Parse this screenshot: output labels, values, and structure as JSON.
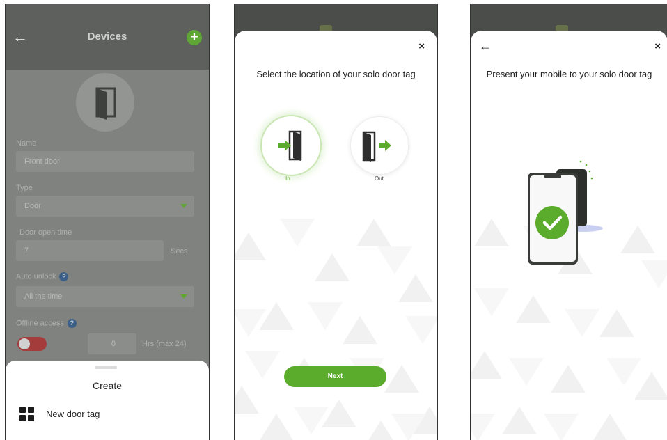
{
  "screen1": {
    "header": {
      "title": "Devices",
      "back_icon": "arrow-left-icon",
      "add_icon": "plus-circle-icon",
      "add_symbol": "+"
    },
    "device_icon": "door-icon",
    "fields": {
      "name_label": "Name",
      "name_value": "Front door",
      "type_label": "Type",
      "type_value": "Door",
      "door_open_label": "Door open time",
      "door_open_value": "7",
      "door_open_unit": "Secs",
      "auto_unlock_label": "Auto unlock",
      "auto_unlock_value": "All the time",
      "offline_label": "Offline access",
      "offline_value": "0",
      "offline_unit": "Hrs (max 24)",
      "help_symbol": "?"
    },
    "sheet": {
      "title": "Create",
      "item_label": "New door tag",
      "item_icon": "grid-icon"
    }
  },
  "screen2": {
    "close_symbol": "×",
    "heading": "Select the location of your solo door tag",
    "options": [
      {
        "label": "In",
        "icon": "door-enter-icon",
        "selected": true
      },
      {
        "label": "Out",
        "icon": "door-exit-icon",
        "selected": false
      }
    ],
    "next_label": "Next"
  },
  "screen3": {
    "back_symbol": "←",
    "close_symbol": "×",
    "heading": "Present your mobile to your solo door tag",
    "illustration_icon": "phone-check-icon"
  },
  "colors": {
    "accent": "#5bab2c",
    "overlay": "#808280",
    "toggle_off": "#a43c3c",
    "help": "#3b5f86"
  }
}
